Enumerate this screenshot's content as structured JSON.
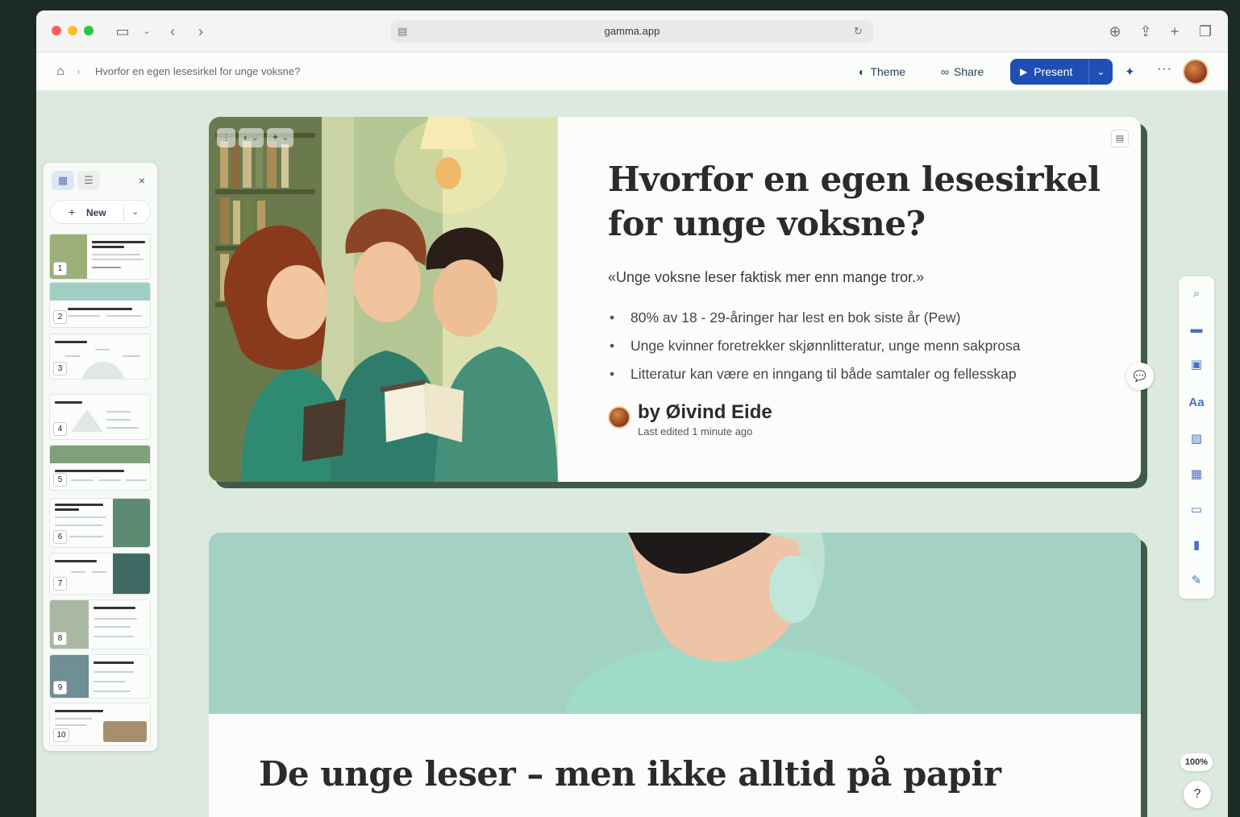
{
  "browser": {
    "url": "gamma.app",
    "icons": {
      "sidebar": "sidebar-icon",
      "back": "chevron-left-icon",
      "forward": "chevron-right-icon",
      "reload": "reload-icon",
      "download": "download-icon",
      "share": "share-icon",
      "newtab": "plus-icon",
      "tabs": "tabs-icon"
    }
  },
  "header": {
    "breadcrumb": "Hvorfor en egen lesesirkel for unge voksne?",
    "theme_label": "Theme",
    "share_label": "Share",
    "present_label": "Present",
    "more_label": "···"
  },
  "sidebar": {
    "new_label": "New",
    "close_label": "×",
    "slides": [
      "1",
      "2",
      "3",
      "4",
      "5",
      "6",
      "7",
      "8",
      "9",
      "10"
    ]
  },
  "card1": {
    "title": "Hvorfor en egen lesesirkel for unge voksne?",
    "quote": "«Unge voksne leser faktisk mer enn mange tror.»",
    "bullets": [
      "80% av 18 - 29-åringer har lest en bok siste år (Pew)",
      "Unge kvinner foretrekker skjønnlitteratur, unge menn sakprosa",
      "Litteratur kan være en inngang til både samtaler og fellesskap"
    ],
    "author": "by Øivind Eide",
    "edited": "Last edited 1 minute ago"
  },
  "card2": {
    "title": "De unge leser – men ikke alltid på papir"
  },
  "zoom": "100%",
  "help": "?",
  "colors": {
    "accent": "#1f4fb4",
    "canvas": "#dce9df",
    "card_shadow": "#3f5a4a"
  }
}
